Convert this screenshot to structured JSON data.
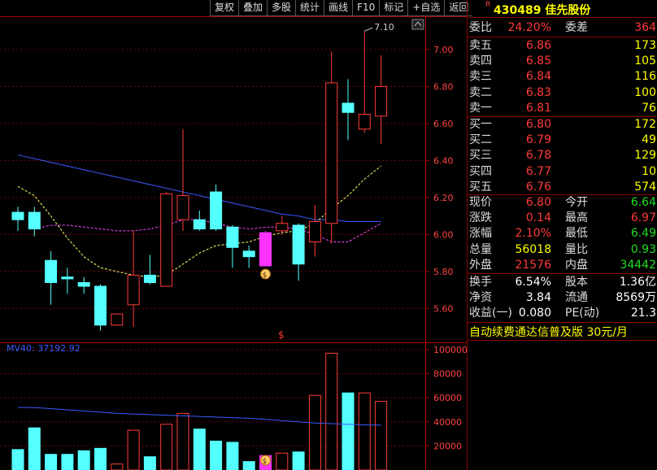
{
  "toolbar": [
    "复权",
    "叠加",
    "多股",
    "统计",
    "画线",
    "F10",
    "标记",
    "+自选",
    "返回"
  ],
  "stock": {
    "r_tag": "R",
    "code": "430489",
    "name": "佳先股份"
  },
  "quote": {
    "weibi": {
      "label": "委比",
      "value": "24.20%",
      "label2": "委差",
      "value2": "364"
    },
    "asks": [
      {
        "label": "卖五",
        "price": "6.86",
        "vol": "173"
      },
      {
        "label": "卖四",
        "price": "6.85",
        "vol": "105"
      },
      {
        "label": "卖三",
        "price": "6.84",
        "vol": "116"
      },
      {
        "label": "卖二",
        "price": "6.83",
        "vol": "100"
      },
      {
        "label": "卖一",
        "price": "6.81",
        "vol": "76"
      }
    ],
    "bids": [
      {
        "label": "买一",
        "price": "6.80",
        "vol": "172"
      },
      {
        "label": "买二",
        "price": "6.79",
        "vol": "49"
      },
      {
        "label": "买三",
        "price": "6.78",
        "vol": "129"
      },
      {
        "label": "买四",
        "price": "6.77",
        "vol": "10"
      },
      {
        "label": "买五",
        "price": "6.76",
        "vol": "574"
      }
    ],
    "stats": [
      {
        "l1": "现价",
        "v1": "6.80",
        "l2": "今开",
        "v2": "6.64"
      },
      {
        "l1": "涨跌",
        "v1": "0.14",
        "l2": "最高",
        "v2": "6.97"
      },
      {
        "l1": "涨幅",
        "v1": "2.10%",
        "l2": "最低",
        "v2": "6.49"
      },
      {
        "l1": "总量",
        "v1": "56018",
        "l2": "量比",
        "v2": "0.93"
      },
      {
        "l1": "外盘",
        "v1": "21576",
        "l2": "内盘",
        "v2": "34442"
      }
    ],
    "fin": [
      {
        "l1": "换手",
        "v1": "6.54%",
        "l2": "股本",
        "v2": "1.36亿"
      },
      {
        "l1": "净资",
        "v1": "3.84",
        "l2": "流通",
        "v2": "8569万"
      },
      {
        "l1": "收益(一)",
        "v1": "0.080",
        "l2": "PE(动)",
        "v2": "21.3"
      }
    ],
    "ad": "自动续费通达信普及版  30元/月"
  },
  "chart_data": [
    {
      "type": "candlestick",
      "y_ticks": [
        "7.00",
        "6.80",
        "6.60",
        "6.40",
        "6.20",
        "6.00",
        "5.80",
        "5.60"
      ],
      "ylim": [
        5.43,
        7.18
      ],
      "high_label": "7.10",
      "marker_label": "$",
      "candles": [
        {
          "o": 6.08,
          "c": 6.12,
          "h": 6.15,
          "l": 6.02
        },
        {
          "o": 6.12,
          "c": 6.03,
          "h": 6.15,
          "l": 5.99
        },
        {
          "o": 5.86,
          "c": 5.74,
          "h": 5.91,
          "l": 5.62
        },
        {
          "o": 5.77,
          "c": 5.76,
          "h": 5.82,
          "l": 5.68
        },
        {
          "o": 5.74,
          "c": 5.72,
          "h": 5.77,
          "l": 5.68
        },
        {
          "o": 5.72,
          "c": 5.51,
          "h": 5.73,
          "l": 5.48
        },
        {
          "o": 5.51,
          "c": 5.57,
          "h": 5.57,
          "l": 5.51
        },
        {
          "o": 5.62,
          "c": 5.78,
          "h": 6.02,
          "l": 5.5
        },
        {
          "o": 5.78,
          "c": 5.74,
          "h": 5.89,
          "l": 5.73
        },
        {
          "o": 5.72,
          "c": 6.22,
          "h": 6.23,
          "l": 5.72
        },
        {
          "o": 6.21,
          "c": 6.08,
          "h": 6.57,
          "l": 6.02
        },
        {
          "o": 6.08,
          "c": 6.03,
          "h": 6.13,
          "l": 6.02
        },
        {
          "o": 6.23,
          "c": 6.03,
          "h": 6.27,
          "l": 6.02
        },
        {
          "o": 6.04,
          "c": 5.93,
          "h": 6.05,
          "l": 5.82
        },
        {
          "o": 5.91,
          "c": 5.88,
          "h": 5.94,
          "l": 5.82
        },
        {
          "o": 6.01,
          "c": 5.83,
          "h": 6.02,
          "l": 5.83
        },
        {
          "o": 6.02,
          "c": 6.06,
          "h": 6.1,
          "l": 6.0
        },
        {
          "o": 6.05,
          "c": 5.84,
          "h": 6.06,
          "l": 5.75
        },
        {
          "o": 5.96,
          "c": 6.07,
          "h": 6.16,
          "l": 5.88
        },
        {
          "o": 6.06,
          "c": 6.82,
          "h": 6.99,
          "l": 5.95
        },
        {
          "o": 6.71,
          "c": 6.66,
          "h": 6.84,
          "l": 6.51
        },
        {
          "o": 6.57,
          "c": 6.65,
          "h": 7.1,
          "l": 6.55
        },
        {
          "o": 6.64,
          "c": 6.8,
          "h": 6.97,
          "l": 6.49
        }
      ],
      "candle_colors": [
        "cyan",
        "cyan",
        "cyan",
        "cyan",
        "cyan",
        "cyan",
        "red",
        "red",
        "cyan",
        "red",
        "red",
        "cyan",
        "cyan",
        "cyan",
        "cyan",
        "magenta",
        "red",
        "cyan",
        "red",
        "red",
        "cyan",
        "red",
        "red"
      ],
      "ma_long": [
        6.43,
        6.41,
        6.39,
        6.37,
        6.35,
        6.33,
        6.31,
        6.29,
        6.27,
        6.25,
        6.23,
        6.21,
        6.19,
        6.17,
        6.15,
        6.13,
        6.11,
        6.1,
        6.08,
        6.08,
        6.07,
        6.07,
        6.07
      ],
      "ma_short_start": 0,
      "ma_short": [
        6.26,
        6.21,
        6.1,
        5.98,
        5.88,
        5.82,
        5.8,
        5.78,
        5.77,
        5.78,
        5.84,
        5.9,
        5.94,
        5.95,
        5.96,
        5.99,
        6.01,
        6.02,
        6.06,
        6.14,
        6.21,
        6.3,
        6.37
      ],
      "ma_mid_start": 1,
      "ma_mid": [
        6.03,
        6.05,
        6.05,
        6.04,
        6.03,
        6.02,
        6.02,
        6.03,
        6.05,
        6.08,
        6.08,
        6.06,
        6.04,
        6.03,
        6.04,
        6.04,
        6.03,
        6.0,
        5.96,
        5.96,
        6.01,
        6.06
      ]
    },
    {
      "type": "bar",
      "label": "MV40: 37192.92",
      "y_ticks": [
        "100000",
        "80000",
        "60000",
        "40000",
        "20000"
      ],
      "ylim": [
        0,
        104000
      ],
      "values": [
        17000,
        35000,
        13000,
        13000,
        16000,
        18000,
        5000,
        33000,
        11000,
        38000,
        47000,
        34000,
        24000,
        23000,
        7000,
        12000,
        14000,
        15000,
        62000,
        97000,
        64000,
        64000,
        57000
      ],
      "marker_label": "$",
      "mv_line": [
        52000,
        51800,
        51000,
        50000,
        49000,
        48000,
        47000,
        46500,
        46000,
        45500,
        45000,
        44500,
        44000,
        43500,
        43000,
        42000,
        41000,
        40000,
        39000,
        38500,
        38000,
        37500,
        37192
      ]
    }
  ]
}
